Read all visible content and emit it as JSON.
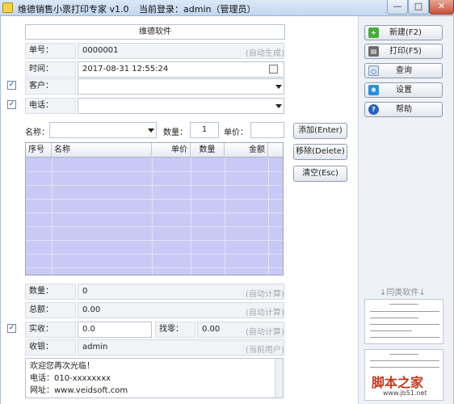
{
  "window": {
    "title": "维德销售小票打印专家 v1.0",
    "login_label": "当前登录：",
    "login_user": "admin（管理员）",
    "minimize": "—",
    "maximize": "□",
    "close": "✕"
  },
  "form": {
    "shop_name": "维德软件",
    "order_no": {
      "label": "单号：",
      "value": "0000001",
      "hint": "(自动生成)"
    },
    "time": {
      "label": "时间：",
      "value": "2017-08-31 12:55:24"
    },
    "customer": {
      "label": "客户：",
      "value": "",
      "checked": true
    },
    "phone": {
      "label": "电话：",
      "value": "",
      "checked": true
    }
  },
  "item_entry": {
    "name_label": "名称：",
    "name_value": "",
    "qty_label": "数量：",
    "qty_value": "1",
    "price_label": "单价：",
    "price_value": ""
  },
  "item_buttons": {
    "add": "添加(Enter)",
    "remove": "移除(Delete)",
    "clear": "清空(Esc)"
  },
  "table": {
    "columns": [
      "序号",
      "名称",
      "单价",
      "数量",
      "金额"
    ],
    "rows": []
  },
  "totals": {
    "count": {
      "label": "数量：",
      "value": "0",
      "hint": "(自动计算)"
    },
    "total": {
      "label": "总额：",
      "value": "0.00",
      "hint": "(自动计算)"
    },
    "received": {
      "label": "实收：",
      "value": "0.0",
      "checked": true
    },
    "change": {
      "label": "找零：",
      "value": "0.00",
      "hint": "(自动计算)"
    },
    "cashier": {
      "label": "收银：",
      "value": "admin",
      "hint": "(当前用户)"
    }
  },
  "footer_message": {
    "line1": "欢迎您再次光临！",
    "line2": "电话：010-xxxxxxxx",
    "line3": "网址：www.veidsoft.com"
  },
  "sidebar": {
    "new": "新建(F2)",
    "print": "打印(F5)",
    "query": "查询",
    "settings": "设置",
    "help": "帮助",
    "similar_software": "↓同类软件↓"
  },
  "watermark": {
    "brand": "脚本之家",
    "url": "www.jb51.net"
  },
  "colors": {
    "grid_fill": "#c9c9f5",
    "titlebar": "#c4d7ef",
    "close_button": "#c8523c"
  }
}
